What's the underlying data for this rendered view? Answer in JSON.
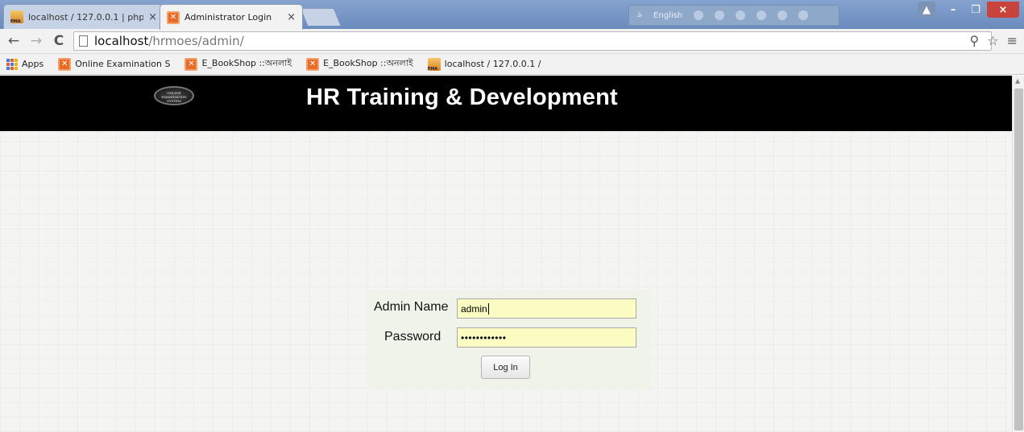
{
  "browser": {
    "tabs": [
      {
        "title": "localhost / 127.0.0.1 | php",
        "active": false,
        "favicon": "pma-icon"
      },
      {
        "title": "Administrator Login",
        "active": true,
        "favicon": "boxx-icon"
      }
    ],
    "tab_close": "×",
    "language_bar": {
      "language": "English"
    },
    "window_controls": {
      "minimize": "–",
      "maximize": "❐",
      "close": "×"
    },
    "address": {
      "host": "localhost",
      "path": "/hrmoes/admin/"
    },
    "nav": {
      "back": "←",
      "forward": "→",
      "reload": "C"
    },
    "toolbar_right": {
      "extension": "⚲",
      "star": "☆",
      "menu": "≡"
    },
    "bookmarks": [
      {
        "label": "Apps",
        "icon": "apps-grid-icon"
      },
      {
        "label": "Online Examination S",
        "icon": "boxx-icon"
      },
      {
        "label": "E_BookShop ::অনলাই",
        "icon": "boxx-icon"
      },
      {
        "label": "E_BookShop ::অনলাই",
        "icon": "boxx-icon"
      },
      {
        "label": "localhost / 127.0.0.1 /",
        "icon": "pma-icon"
      }
    ]
  },
  "page": {
    "logo_text": "ONLINE EXAMINATION SYSTEM",
    "title": "HR Training & Development",
    "login": {
      "admin_name_label": "Admin Name",
      "admin_name_value": "admin",
      "password_label": "Password",
      "password_value": "••••••••••••",
      "submit_label": "Log In"
    }
  },
  "colors": {
    "header_bg": "#000000",
    "input_bg": "#fafcc1",
    "panel_bg": "#eff3ea"
  }
}
